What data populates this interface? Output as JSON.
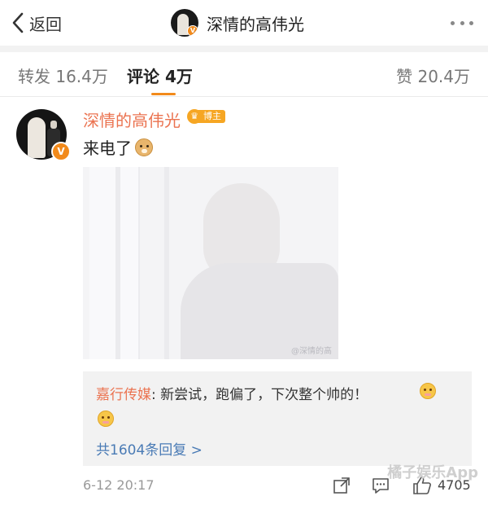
{
  "nav": {
    "back_label": "返回",
    "title": "深情的高伟光",
    "verified_mark": "V"
  },
  "tabs": {
    "repost_label": "转发 16.4万",
    "comments_label": "评论 4万",
    "likes_label": "赞 20.4万"
  },
  "comment": {
    "author": "深情的高伟光",
    "author_badge": "博主",
    "crown_glyph": "♛",
    "verified_mark": "V",
    "text": "来电了",
    "text_emoji": "doge",
    "photo_watermark": "@深情的高"
  },
  "replies": {
    "first_author": "嘉行传媒",
    "first_text": ": 新尝试，跑偏了，下次整个帅的！",
    "emoji": "cute-face",
    "total_label": "共1604条回复 >"
  },
  "footer": {
    "time": "6-12 20:17",
    "like_count": "4705"
  },
  "watermark": "橘子娱乐App",
  "colors": {
    "accent": "#f28a1b",
    "name_link": "#eb7350",
    "reply_link": "#4a7bb5"
  }
}
